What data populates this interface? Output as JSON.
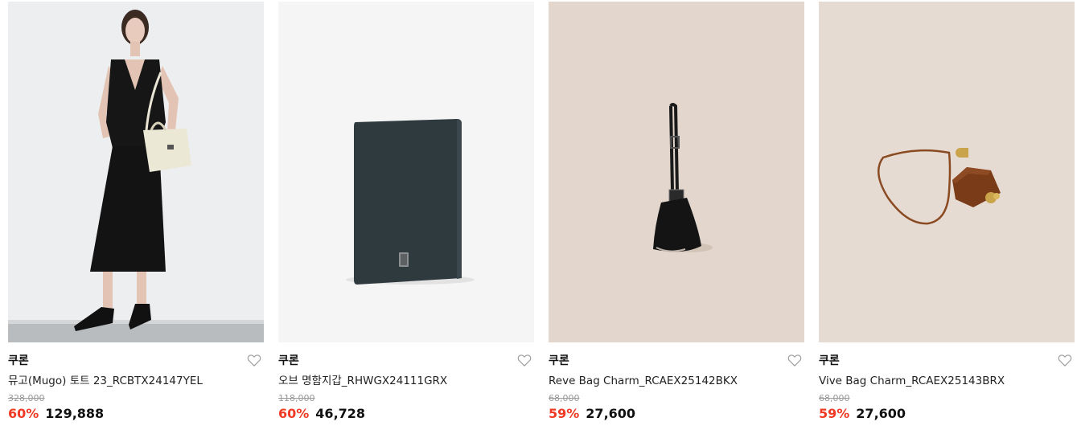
{
  "colors": {
    "discount": "#ef3a24",
    "original_price": "#9a9a9a",
    "text": "#111111"
  },
  "products": [
    {
      "brand": "쿠론",
      "name": "뮤고(Mugo) 토트 23_RCBTX24147YEL",
      "original_price": "328,000",
      "discount": "60%",
      "sale_price": "129,888",
      "image": "model-with-tote-bag",
      "wishlist_icon": "heart-outline-icon"
    },
    {
      "brand": "쿠론",
      "name": "오브 명함지갑_RHWGX24111GRX",
      "original_price": "118,000",
      "discount": "60%",
      "sale_price": "46,728",
      "image": "dark-card-wallet",
      "wishlist_icon": "heart-outline-icon"
    },
    {
      "brand": "쿠론",
      "name": "Reve Bag Charm_RCAEX25142BKX",
      "original_price": "68,000",
      "discount": "59%",
      "sale_price": "27,600",
      "image": "black-bag-charm",
      "wishlist_icon": "heart-outline-icon"
    },
    {
      "brand": "쿠론",
      "name": "Vive Bag Charm_RCAEX25143BRX",
      "original_price": "68,000",
      "discount": "59%",
      "sale_price": "27,600",
      "image": "brown-bag-charm",
      "wishlist_icon": "heart-outline-icon"
    }
  ]
}
